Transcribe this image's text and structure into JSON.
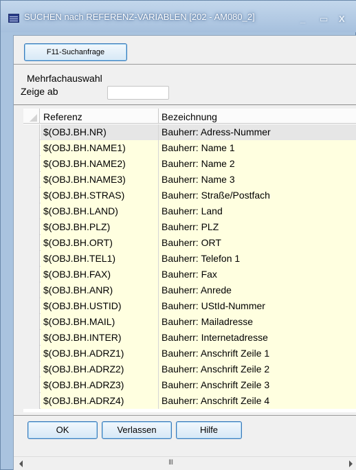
{
  "window": {
    "title": "SUCHEN nach REFERENZ-VARIABLEN  [202 - AM080_2]",
    "minimize_icon": "minimize-icon",
    "maximize_icon": "maximize-icon",
    "close_icon": "close-icon",
    "minimize_glyph": "_",
    "maximize_glyph": "▭",
    "close_glyph": "X"
  },
  "toolbar": {
    "f11_label": "F11-Suchanfrage"
  },
  "filter": {
    "multi_label": "Mehrfachauswahl",
    "zeige_label": "Zeige ab",
    "zeige_value": ""
  },
  "table": {
    "columns": [
      "Referenz",
      "Bezeichnung"
    ],
    "rows": [
      {
        "ref": "$(OBJ.BH.NR)",
        "bez": "Bauherr: Adress-Nummer",
        "selected": true
      },
      {
        "ref": "$(OBJ.BH.NAME1)",
        "bez": "Bauherr: Name 1"
      },
      {
        "ref": "$(OBJ.BH.NAME2)",
        "bez": "Bauherr: Name 2"
      },
      {
        "ref": "$(OBJ.BH.NAME3)",
        "bez": "Bauherr: Name 3"
      },
      {
        "ref": "$(OBJ.BH.STRAS)",
        "bez": "Bauherr: Straße/Postfach"
      },
      {
        "ref": "$(OBJ.BH.LAND)",
        "bez": "Bauherr: Land"
      },
      {
        "ref": "$(OBJ.BH.PLZ)",
        "bez": "Bauherr: PLZ"
      },
      {
        "ref": "$(OBJ.BH.ORT)",
        "bez": "Bauherr: ORT"
      },
      {
        "ref": "$(OBJ.BH.TEL1)",
        "bez": "Bauherr: Telefon 1"
      },
      {
        "ref": "$(OBJ.BH.FAX)",
        "bez": "Bauherr: Fax"
      },
      {
        "ref": "$(OBJ.BH.ANR)",
        "bez": "Bauherr: Anrede"
      },
      {
        "ref": "$(OBJ.BH.USTID)",
        "bez": "Bauherr: UStId-Nummer"
      },
      {
        "ref": "$(OBJ.BH.MAIL)",
        "bez": "Bauherr: Mailadresse"
      },
      {
        "ref": "$(OBJ.BH.INTER)",
        "bez": "Bauherr: Internetadresse"
      },
      {
        "ref": "$(OBJ.BH.ADRZ1)",
        "bez": "Bauherr: Anschrift Zeile 1"
      },
      {
        "ref": "$(OBJ.BH.ADRZ2)",
        "bez": "Bauherr: Anschrift Zeile 2"
      },
      {
        "ref": "$(OBJ.BH.ADRZ3)",
        "bez": "Bauherr: Anschrift Zeile 3"
      },
      {
        "ref": "$(OBJ.BH.ADRZ4)",
        "bez": "Bauherr: Anschrift Zeile 4"
      }
    ]
  },
  "buttons": {
    "ok": "OK",
    "verlassen": "Verlassen",
    "hilfe": "Hilfe"
  },
  "scrollbar": {
    "grip": "III"
  },
  "colors": {
    "row_bg": "#ffffe0",
    "selected_row_bg": "#e6e6e6",
    "accent_border": "#3a78b8"
  }
}
